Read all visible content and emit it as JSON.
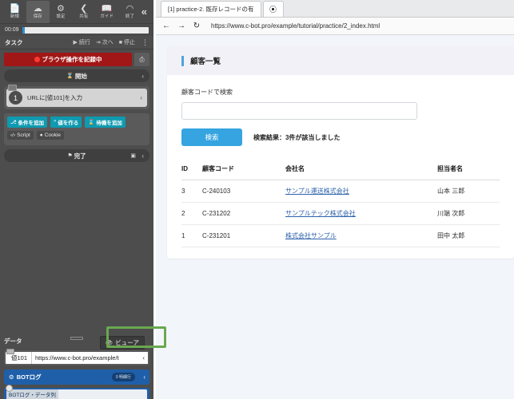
{
  "rpa_panel": {
    "toolbar": {
      "buttons": [
        {
          "label": "新規",
          "icon": "document-icon",
          "active": false
        },
        {
          "label": "保存",
          "icon": "cloud-save-icon",
          "active": true
        },
        {
          "label": "設定",
          "icon": "gear-icon",
          "active": false
        },
        {
          "label": "共有",
          "icon": "share-icon",
          "active": false
        },
        {
          "label": "ガイド",
          "icon": "book-icon",
          "active": false
        },
        {
          "label": "終了",
          "icon": "exit-door-icon",
          "active": false
        }
      ],
      "collapse_icon": "double-chevron-left-icon"
    },
    "timer": {
      "elapsed": "00:09",
      "progress_percent": 2
    },
    "task_row": {
      "label": "タスク",
      "continue_label": "続行",
      "next_label": "次へ",
      "stop_label": "停止",
      "menu_icon": "vertical-dots-icon"
    },
    "recording_banner": {
      "label": "ブラウザ操作を記録中",
      "side_icon": "window-capture-icon"
    },
    "start_bar": {
      "label": "開始",
      "icon": "hourglass-icon",
      "chevron": "‹"
    },
    "step": {
      "number": "1",
      "text": "URLに[値101]を入力",
      "chevron": "‹"
    },
    "chips": [
      {
        "label": "条件を追加",
        "icon": "branch-icon",
        "style": "teal"
      },
      {
        "label": "値を作る",
        "icon": "quote-icon",
        "style": "teal"
      },
      {
        "label": "待機を追加",
        "icon": "hourglass-icon",
        "style": "teal"
      },
      {
        "label": "Script",
        "icon": "code-icon",
        "style": "dark"
      },
      {
        "label": "Cookie",
        "icon": "cookie-icon",
        "style": "dark"
      }
    ],
    "end_bar": {
      "label": "完了",
      "icon": "flag-icon",
      "camera_icon": "camera-icon",
      "chevron": "‹"
    },
    "data_section": {
      "title": "データ",
      "viewer_button": {
        "label": "ビューア",
        "icon": "eye-icon"
      },
      "highlight_color": "#6aa84f",
      "rows": [
        {
          "key": "値101",
          "value": "https://www.c-bot.pro/example/t",
          "chevron": "‹"
        }
      ]
    },
    "bot_log": {
      "title": "BOTログ",
      "icon": "robot-icon",
      "badge": "0 明細行",
      "chevron": "‹",
      "row": {
        "key": "BOTログ・データ列",
        "value": ""
      }
    }
  },
  "browser": {
    "tab": {
      "title": "[1] practice-2. 既存レコードの有",
      "new_tab_icon": "plus-circle-icon"
    },
    "nav": {
      "back_icon": "arrow-left-icon",
      "forward_icon": "arrow-right-icon",
      "reload_icon": "reload-icon",
      "url": "https://www.c-bot.pro/example/tutorial/practice/2_index.html"
    }
  },
  "page": {
    "card_title": "顧客一覧",
    "search": {
      "label": "顧客コードで検索",
      "value": "",
      "placeholder": "",
      "button_label": "検索",
      "result_text": "検索結果：3件が該当しました",
      "accent_color": "#35a4e0"
    },
    "table": {
      "columns": [
        "ID",
        "顧客コード",
        "会社名",
        "担当者名"
      ],
      "rows": [
        {
          "id": "3",
          "code": "C-240103",
          "company": "サンプル運送株式会社",
          "person": "山本 三郎"
        },
        {
          "id": "2",
          "code": "C-231202",
          "company": "サンプルテック株式会社",
          "person": "川端 次郎"
        },
        {
          "id": "1",
          "code": "C-231201",
          "company": "株式会社サンプル",
          "person": "田中 太郎"
        }
      ]
    }
  }
}
